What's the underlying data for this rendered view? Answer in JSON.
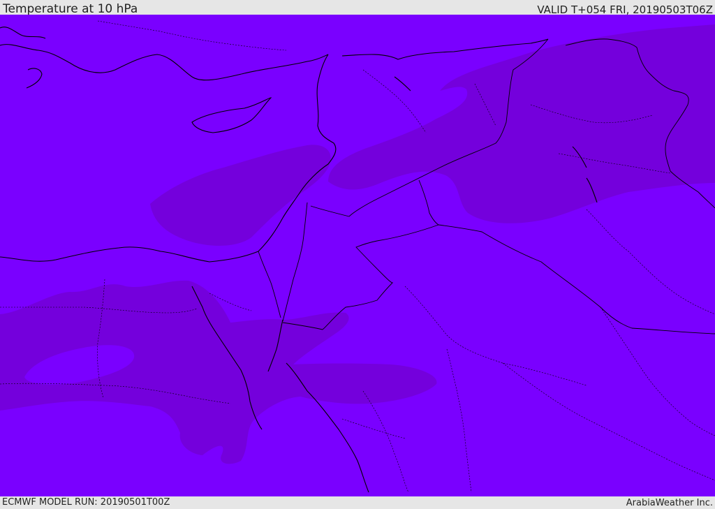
{
  "header": {
    "title": "Temperature at 10 hPa",
    "valid_time": "VALID T+054 FRI, 20190503T06Z"
  },
  "footer": {
    "model_run": "ECMWF MODEL RUN: 20190501T00Z",
    "credit": "ArabiaWeather Inc."
  },
  "map": {
    "variable": "Temperature at 10 hPa",
    "colors": {
      "base_field": "#7a00ff",
      "warmer_band": "#7400dc",
      "coastline": "#000000",
      "borders": "#000000"
    }
  }
}
